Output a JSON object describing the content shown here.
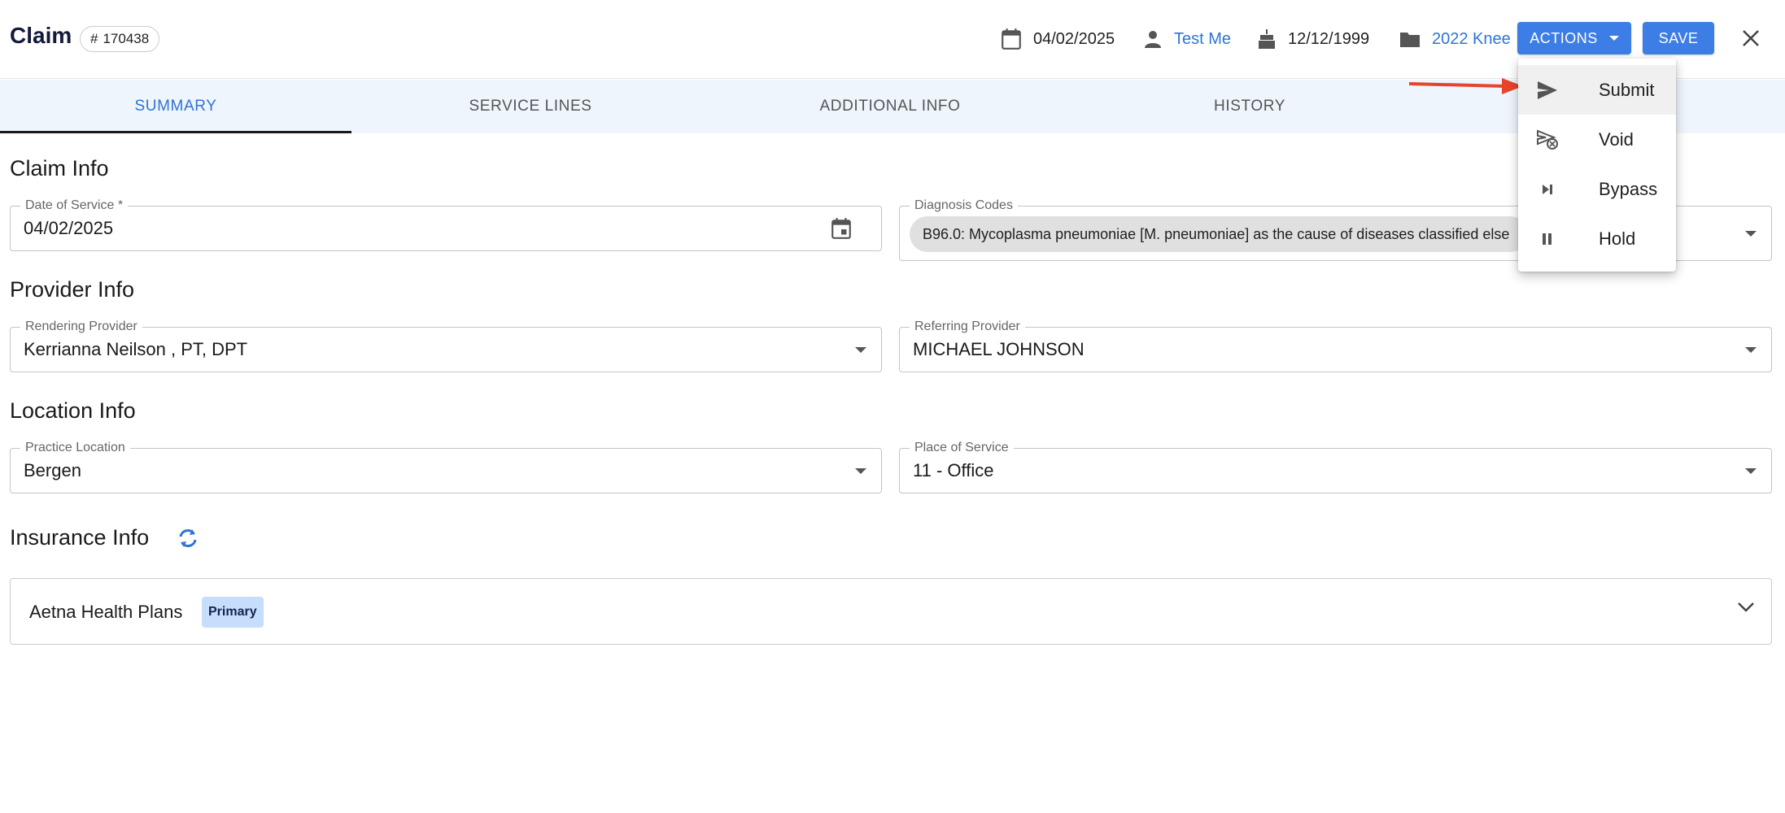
{
  "header": {
    "title": "Claim",
    "claim_number": "170438",
    "date": "04/02/2025",
    "patient_name": "Test Me",
    "dob": "12/12/1999",
    "case_name": "2022 Knee",
    "actions_label": "ACTIONS",
    "save_label": "SAVE"
  },
  "tabs": [
    {
      "label": "SUMMARY",
      "active": true
    },
    {
      "label": "SERVICE LINES",
      "active": false
    },
    {
      "label": "ADDITIONAL INFO",
      "active": false
    },
    {
      "label": "HISTORY",
      "active": false
    }
  ],
  "claim_info": {
    "title": "Claim Info",
    "date_of_service_label": "Date of Service *",
    "date_of_service_value": "04/02/2025",
    "diagnosis_label": "Diagnosis Codes",
    "diagnosis_value": "B96.0: Mycoplasma pneumoniae [M. pneumoniae] as the cause of diseases classified else"
  },
  "provider_info": {
    "title": "Provider Info",
    "rendering_label": "Rendering Provider",
    "rendering_value": "Kerrianna Neilson , PT, DPT",
    "referring_label": "Referring Provider",
    "referring_value": "MICHAEL JOHNSON"
  },
  "location_info": {
    "title": "Location Info",
    "practice_label": "Practice Location",
    "practice_value": "Bergen",
    "pos_label": "Place of Service",
    "pos_value": "11 - Office"
  },
  "insurance_info": {
    "title": "Insurance Info",
    "plan_name": "Aetna Health Plans",
    "plan_badge": "Primary"
  },
  "actions_menu": {
    "items": [
      {
        "label": "Submit",
        "icon": "send-icon"
      },
      {
        "label": "Void",
        "icon": "void-icon"
      },
      {
        "label": "Bypass",
        "icon": "skip-next-icon"
      },
      {
        "label": "Hold",
        "icon": "pause-icon"
      }
    ]
  },
  "colors": {
    "primary": "#3d7ee6",
    "link": "#2f74d6",
    "tab_bar": "#eef5fc",
    "annotation_arrow": "#e8442d",
    "badge_bg": "#c6ddfb"
  }
}
